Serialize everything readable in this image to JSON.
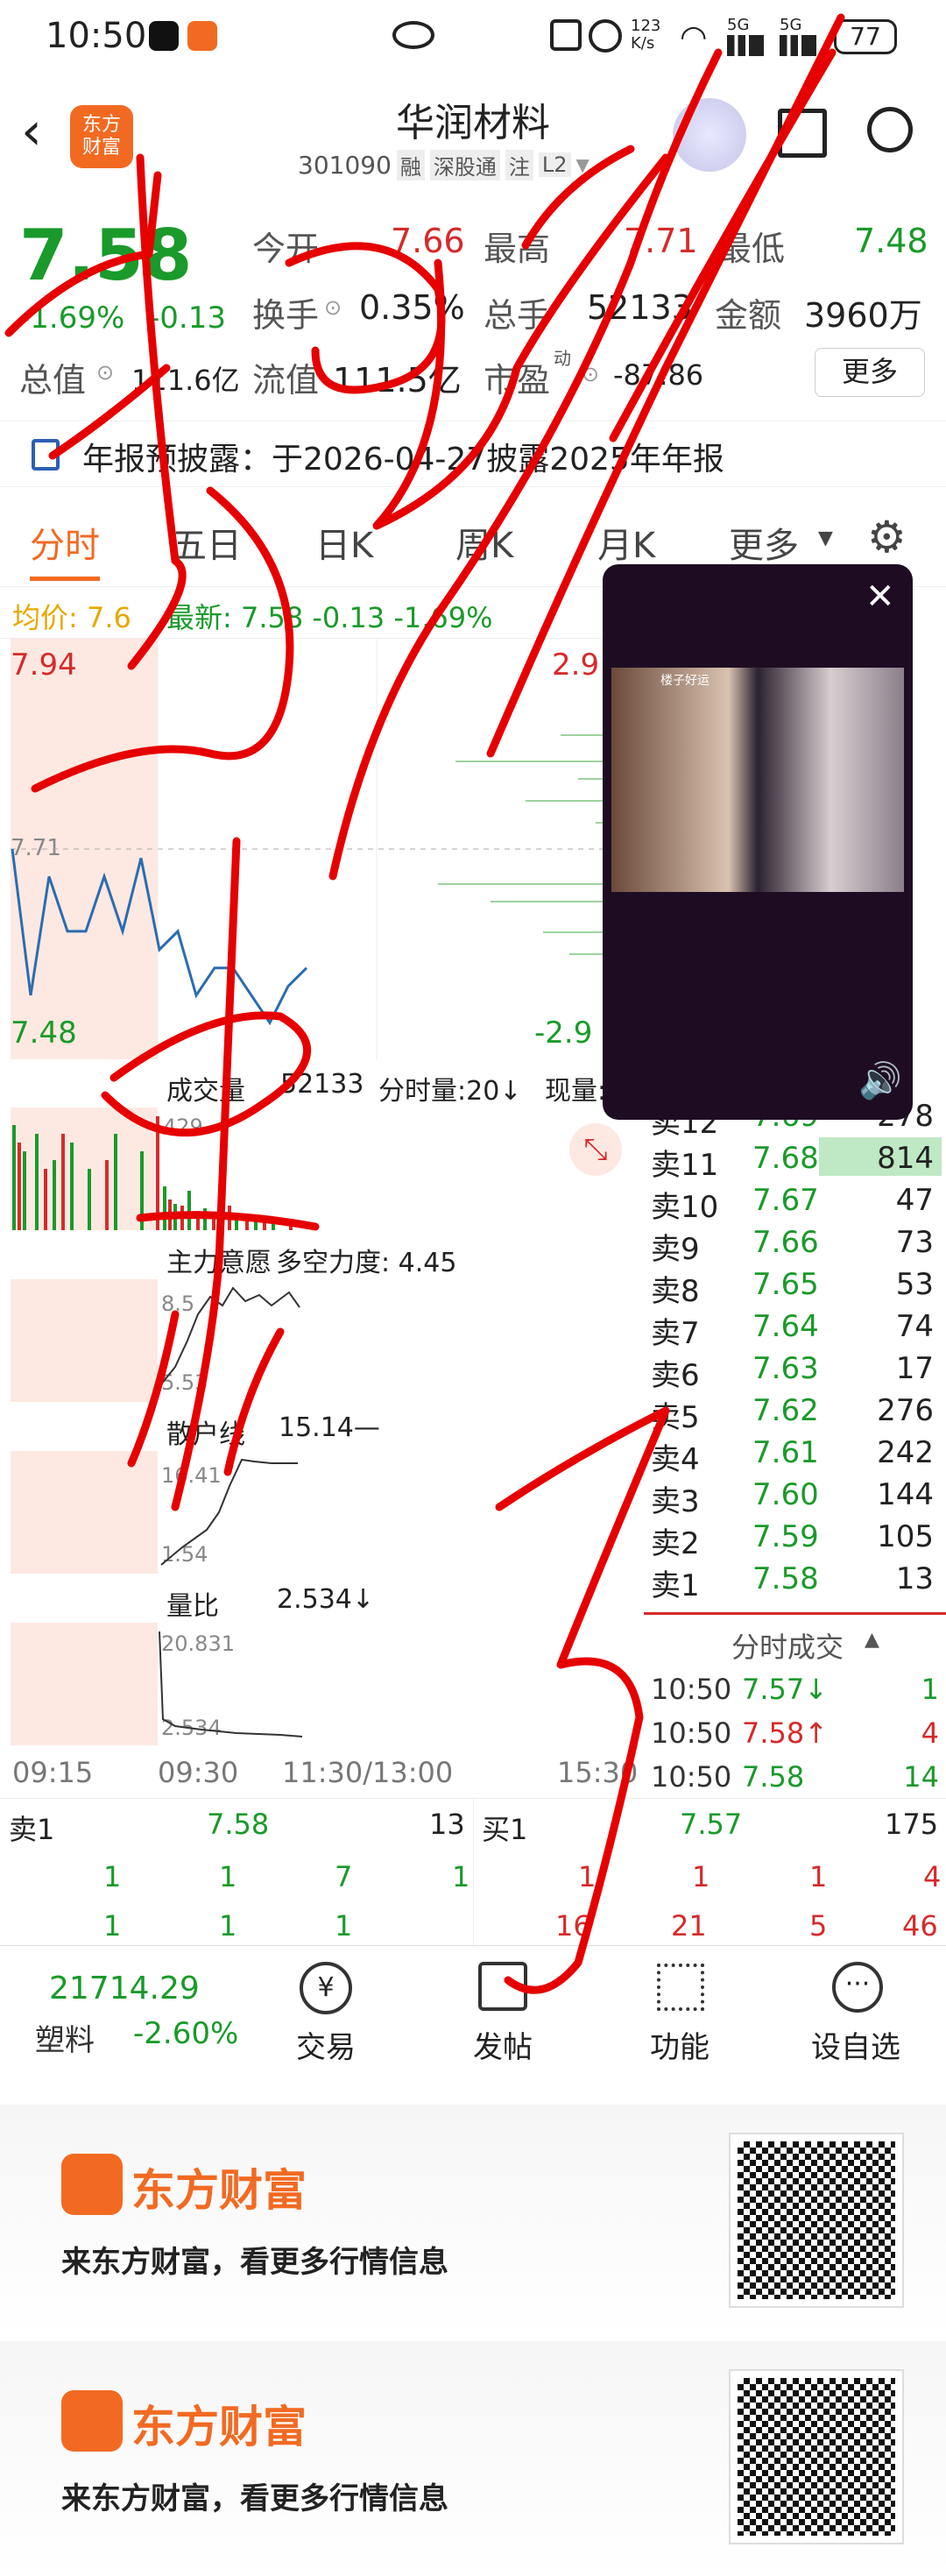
{
  "status": {
    "time": "10:50",
    "net_speed": "123\nK/s",
    "battery": "77",
    "net1": "5G",
    "net2": "5G"
  },
  "header": {
    "app_logo_text": "东方\n财富",
    "title": "华润材料",
    "code": "301090",
    "tags": [
      "融",
      "深股通",
      "注",
      "L2"
    ]
  },
  "quote": {
    "price": "7.58",
    "change_pct": "-1.69%",
    "change": "-0.13",
    "open_label": "今开",
    "open": "7.66",
    "high_label": "最高",
    "high": "7.71",
    "low_label": "最低",
    "low": "7.48",
    "turnover_label": "换手",
    "turnover": "0.35%",
    "volume_label": "总手",
    "volume": "52133",
    "amount_label": "金额",
    "amount": "3960万",
    "mktcap_label": "总值",
    "mktcap": "111.6亿",
    "float_label": "流值",
    "float": "111.5亿",
    "pe_label": "市盈",
    "pe_sup": "动",
    "pe": "-87.86",
    "more_button": "更多"
  },
  "notice": {
    "text": "年报预披露：于2026-04-27披露2025年年报"
  },
  "tabs": [
    "分时",
    "五日",
    "日K",
    "周K",
    "月K",
    "更多"
  ],
  "intraday": {
    "avg_label": "均价: 7.6",
    "latest_label": "最新: 7.58 -0.13 -1.69%",
    "top_price": "7.94",
    "bottom_price": "7.48",
    "mid_price": "7.71",
    "top_pct": "2.9",
    "bottom_pct": "-2.9",
    "vol_label": "成交量",
    "vol_value": "52133",
    "vol_period": "分时量:20↓",
    "vol_now": "现量:",
    "vol_axis": "429",
    "ind1_label": "主力意愿",
    "ind1_extra": "多空力度: 4.45",
    "ind1_axis_hi": "8.5",
    "ind1_axis_lo": "5.53",
    "ind2_label": "散户线",
    "ind2_value": "15.14—",
    "ind2_axis_hi": "16.41",
    "ind2_axis_lo": "1.54",
    "ind3_label": "量比",
    "ind3_value": "2.534↓",
    "ind3_axis_hi": "20.831",
    "ind3_axis_lo": "2.534",
    "times": [
      "09:15",
      "09:30",
      "11:30/13:00",
      "15:30"
    ]
  },
  "chart_data": {
    "type": "line",
    "x": [
      "09:30",
      "09:35",
      "09:40",
      "09:45",
      "09:50",
      "09:55",
      "10:00",
      "10:05",
      "10:10",
      "10:15",
      "10:20",
      "10:25",
      "10:30",
      "10:35",
      "10:40",
      "10:45",
      "10:50"
    ],
    "series": [
      {
        "values": [
          7.71,
          7.55,
          7.68,
          7.62,
          7.62,
          7.68,
          7.62,
          7.7,
          7.6,
          7.62,
          7.55,
          7.58,
          7.58,
          7.55,
          7.52,
          7.56,
          7.58
        ]
      }
    ],
    "ylim": [
      7.48,
      7.94
    ]
  },
  "orderbook": {
    "rows": [
      {
        "label": "卖12",
        "price": "7.69",
        "vol": "278"
      },
      {
        "label": "卖11",
        "price": "7.68",
        "vol": "814"
      },
      {
        "label": "卖10",
        "price": "7.67",
        "vol": "47"
      },
      {
        "label": "卖9",
        "price": "7.66",
        "vol": "73"
      },
      {
        "label": "卖8",
        "price": "7.65",
        "vol": "53"
      },
      {
        "label": "卖7",
        "price": "7.64",
        "vol": "74"
      },
      {
        "label": "卖6",
        "price": "7.63",
        "vol": "17"
      },
      {
        "label": "卖5",
        "price": "7.62",
        "vol": "276"
      },
      {
        "label": "卖4",
        "price": "7.61",
        "vol": "242"
      },
      {
        "label": "卖3",
        "price": "7.60",
        "vol": "144"
      },
      {
        "label": "卖2",
        "price": "7.59",
        "vol": "105"
      },
      {
        "label": "卖1",
        "price": "7.58",
        "vol": "13"
      }
    ],
    "trades_header": "分时成交",
    "trades": [
      {
        "time": "10:50",
        "price": "7.57↓",
        "vol": "1"
      },
      {
        "time": "10:50",
        "price": "7.58↑",
        "vol": "4"
      },
      {
        "time": "10:50",
        "price": "7.58",
        "vol": "14"
      }
    ]
  },
  "l2": {
    "sell_label": "卖1",
    "sell_price": "7.58",
    "sell_vol": "13",
    "buy_label": "买1",
    "buy_price": "7.57",
    "buy_vol": "175",
    "sell_q1": [
      "1",
      "1",
      "7",
      "1"
    ],
    "sell_q2": [
      "1",
      "1",
      "1"
    ],
    "buy_q1": [
      "1",
      "1",
      "1",
      "4"
    ],
    "buy_q2": [
      "16",
      "21",
      "5",
      "46"
    ]
  },
  "bottomnav": {
    "index_value": "21714.29",
    "index_name": "塑料",
    "index_change": "-2.60%",
    "trade": "交易",
    "post": "发帖",
    "func": "功能",
    "watch": "设自选"
  },
  "ad": {
    "brand": "东方财富",
    "slogan": "来东方财富，看更多行情信息"
  },
  "video": {
    "caption": "楼子好运"
  }
}
